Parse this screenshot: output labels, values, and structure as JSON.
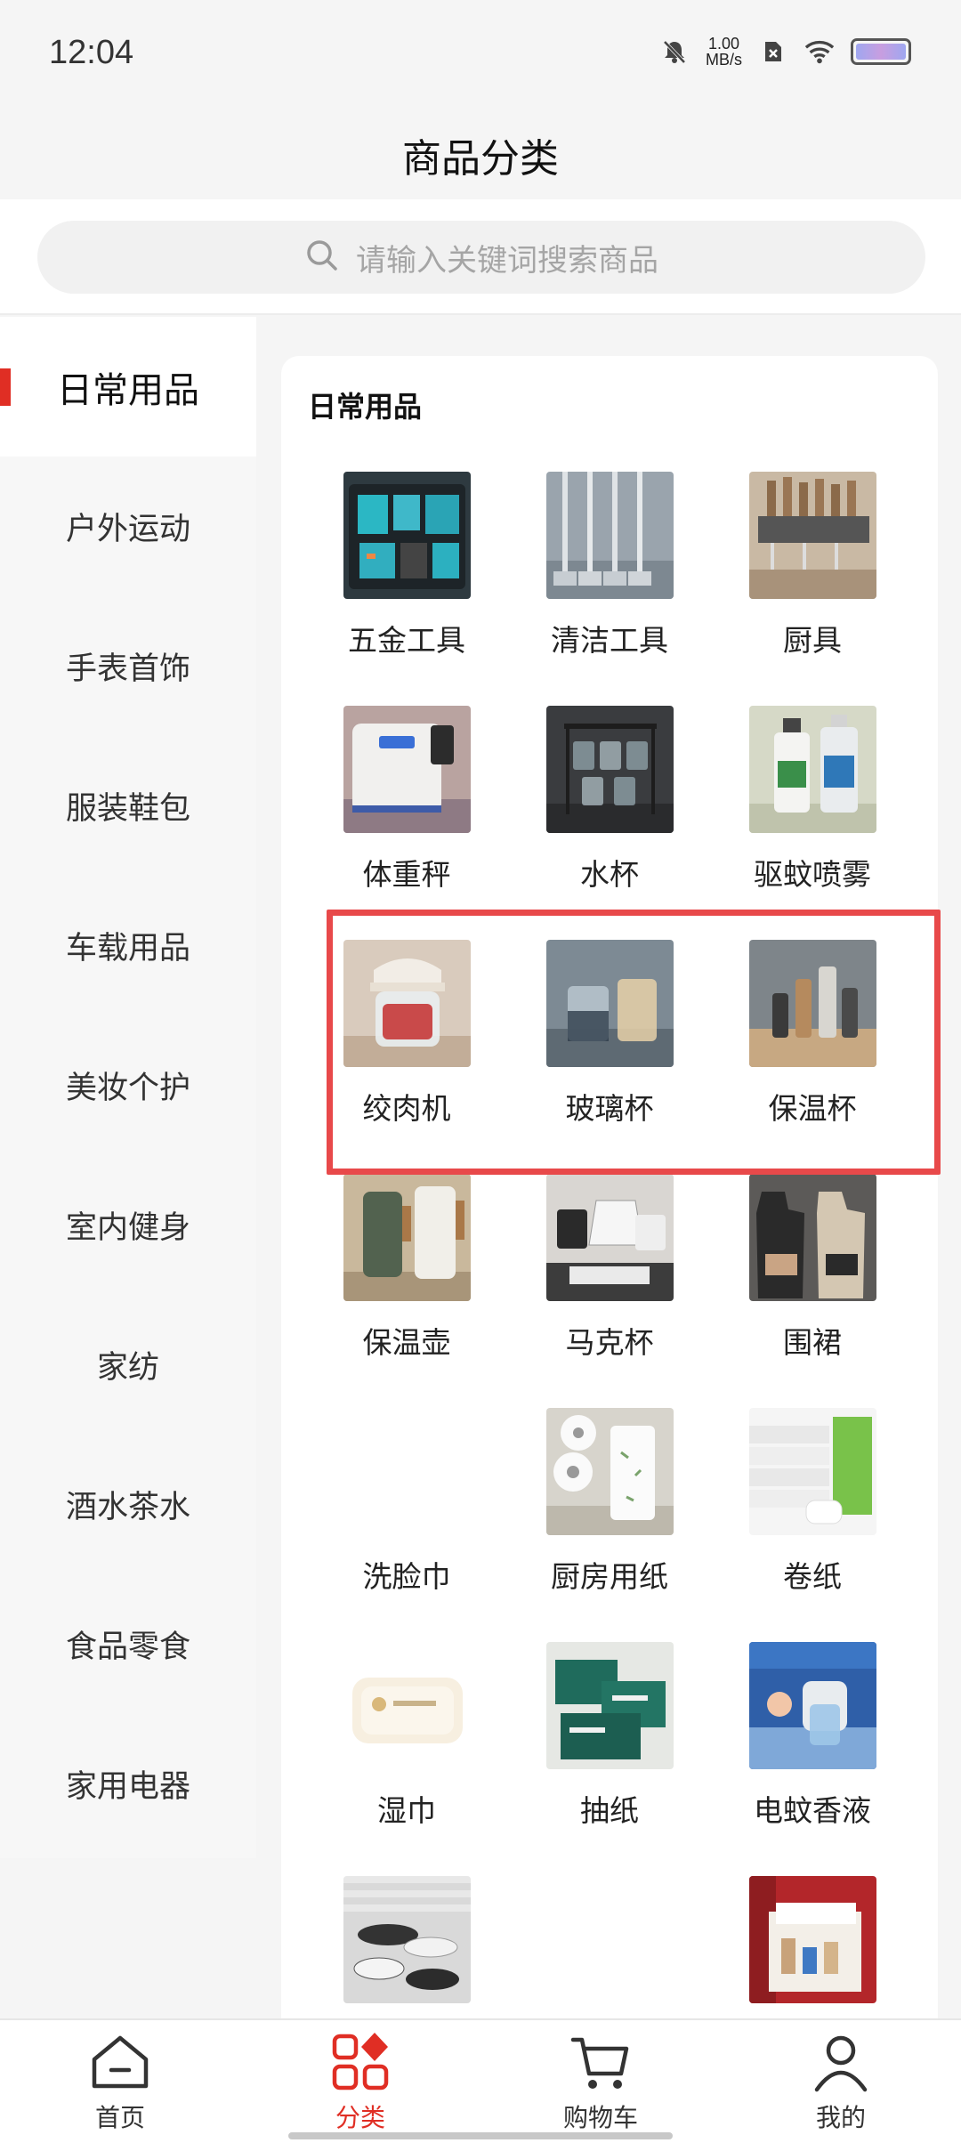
{
  "status_bar": {
    "time": "12:04",
    "net_speed_value": "1.00",
    "net_speed_unit": "MB/s"
  },
  "header": {
    "title": "商品分类"
  },
  "search": {
    "placeholder": "请输入关键词搜索商品"
  },
  "sidebar": {
    "items": [
      {
        "label": "日常用品",
        "active": true
      },
      {
        "label": "户外运动",
        "active": false
      },
      {
        "label": "手表首饰",
        "active": false
      },
      {
        "label": "服装鞋包",
        "active": false
      },
      {
        "label": "车载用品",
        "active": false
      },
      {
        "label": "美妆个护",
        "active": false
      },
      {
        "label": "室内健身",
        "active": false
      },
      {
        "label": "家纺",
        "active": false
      },
      {
        "label": "酒水茶水",
        "active": false
      },
      {
        "label": "食品零食",
        "active": false
      },
      {
        "label": "家用电器",
        "active": false
      }
    ]
  },
  "content": {
    "section_title": "日常用品",
    "items": [
      {
        "label": "五金工具",
        "image": "power-tools-case"
      },
      {
        "label": "清洁工具",
        "image": "mops"
      },
      {
        "label": "厨具",
        "image": "knife-rack"
      },
      {
        "label": "体重秤",
        "image": "weight-scale"
      },
      {
        "label": "水杯",
        "image": "glass-cups-rack"
      },
      {
        "label": "驱蚊喷雾",
        "image": "spray-bottles"
      },
      {
        "label": "绞肉机",
        "image": "meat-grinder"
      },
      {
        "label": "玻璃杯",
        "image": "glass-cups"
      },
      {
        "label": "保温杯",
        "image": "thermos-cups"
      },
      {
        "label": "保温壶",
        "image": "thermal-kettle"
      },
      {
        "label": "马克杯",
        "image": "mugs"
      },
      {
        "label": "围裙",
        "image": "aprons"
      },
      {
        "label": "洗脸巾",
        "image": ""
      },
      {
        "label": "厨房用纸",
        "image": "kitchen-paper-rolls"
      },
      {
        "label": "卷纸",
        "image": "toilet-paper-rolls"
      },
      {
        "label": "湿巾",
        "image": "wet-wipes"
      },
      {
        "label": "抽纸",
        "image": "tissue-boxes"
      },
      {
        "label": "电蚊香液",
        "image": "mosquito-liquid-device"
      },
      {
        "label": "",
        "image": "dinnerware-set"
      },
      {
        "label": "",
        "image": ""
      },
      {
        "label": "",
        "image": "gift-box-set"
      }
    ]
  },
  "tabbar": {
    "tabs": [
      {
        "label": "首页",
        "icon": "home-icon",
        "active": false
      },
      {
        "label": "分类",
        "icon": "category-icon",
        "active": true
      },
      {
        "label": "购物车",
        "icon": "cart-icon",
        "active": false
      },
      {
        "label": "我的",
        "icon": "user-icon",
        "active": false
      }
    ]
  },
  "colors": {
    "accent": "#e02e24",
    "highlight": "#e8494a",
    "background": "#f5f5f5"
  }
}
